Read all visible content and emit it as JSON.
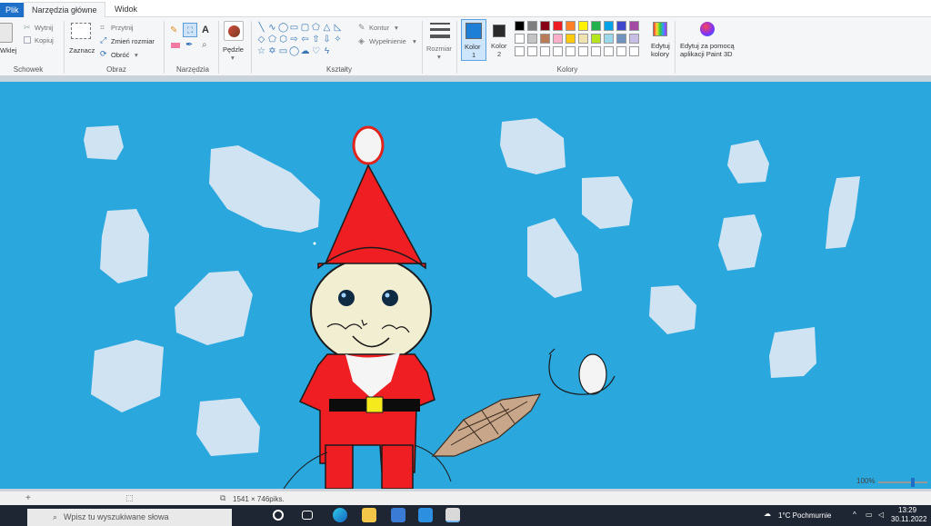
{
  "tabs": {
    "file": "Plik",
    "home": "Narzędzia główne",
    "view": "Widok"
  },
  "ribbon": {
    "clipboard": {
      "paste": "Wklej",
      "cut": "Wytnij",
      "copy": "Kopiuj",
      "label": "Schowek"
    },
    "image": {
      "select": "Zaznacz",
      "crop": "Przytnij",
      "resize": "Zmień rozmiar",
      "rotate": "Obróć",
      "label": "Obraz"
    },
    "tools": {
      "label": "Narzędzia"
    },
    "brushes": {
      "label": "Pędzle"
    },
    "shapes": {
      "outline": "Kontur",
      "fill": "Wypełnienie",
      "label": "Kształty"
    },
    "size": {
      "label": "Rozmiar"
    },
    "colors": {
      "color1_a": "Kolor",
      "color1_b": "1",
      "color2_a": "Kolor",
      "color2_b": "2",
      "edit_a": "Edytuj",
      "edit_b": "kolory",
      "label": "Kolory",
      "color1_value": "#1e7fd6",
      "color2_value": "#2a2a2a",
      "palette": [
        "#000000",
        "#7f7f7f",
        "#880015",
        "#ed1c24",
        "#ff7f27",
        "#fff200",
        "#22b14c",
        "#00a2e8",
        "#3f48cc",
        "#a349a4",
        "#ffffff",
        "#c3c3c3",
        "#b97a57",
        "#ffaec9",
        "#ffc90e",
        "#efe4b0",
        "#b5e61d",
        "#99d9ea",
        "#7092be",
        "#c8bfe7"
      ]
    },
    "paint3d": {
      "line1": "Edytuj za pomocą",
      "line2": "aplikacji Paint 3D"
    }
  },
  "canvas": {
    "background": "#2aa7dd"
  },
  "statusbar": {
    "dimensions": "1541 × 746piks.",
    "zoom": "100%"
  },
  "taskbar": {
    "search_placeholder": "Wpisz tu wyszukiwane słowa",
    "weather": "1°C  Pochmurnie",
    "time": "13:29",
    "date": "30.11.2022"
  }
}
